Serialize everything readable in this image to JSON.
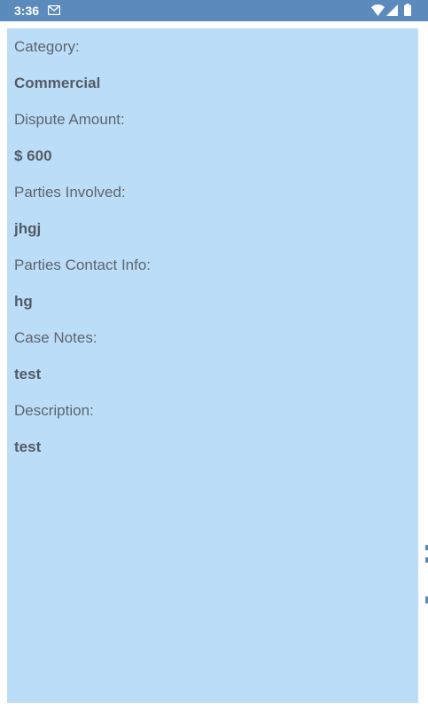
{
  "status_bar": {
    "time": "3:36",
    "icons": [
      "mail-icon",
      "wifi-icon",
      "signal-icon",
      "battery-icon"
    ]
  },
  "colors": {
    "status_bar": "#5b8bbd",
    "panel_background": "#bbddf7",
    "label_text": "#5c6670",
    "value_text": "#525c66"
  },
  "details": {
    "fields": [
      {
        "label": "Category:",
        "value": "Commercial"
      },
      {
        "label": "Dispute Amount:",
        "value": "$ 600"
      },
      {
        "label": "Parties Involved:",
        "value": "jhgj"
      },
      {
        "label": "Parties Contact Info:",
        "value": "hg"
      },
      {
        "label": "Case Notes:",
        "value": "test"
      },
      {
        "label": "Description:",
        "value": "test"
      }
    ]
  }
}
